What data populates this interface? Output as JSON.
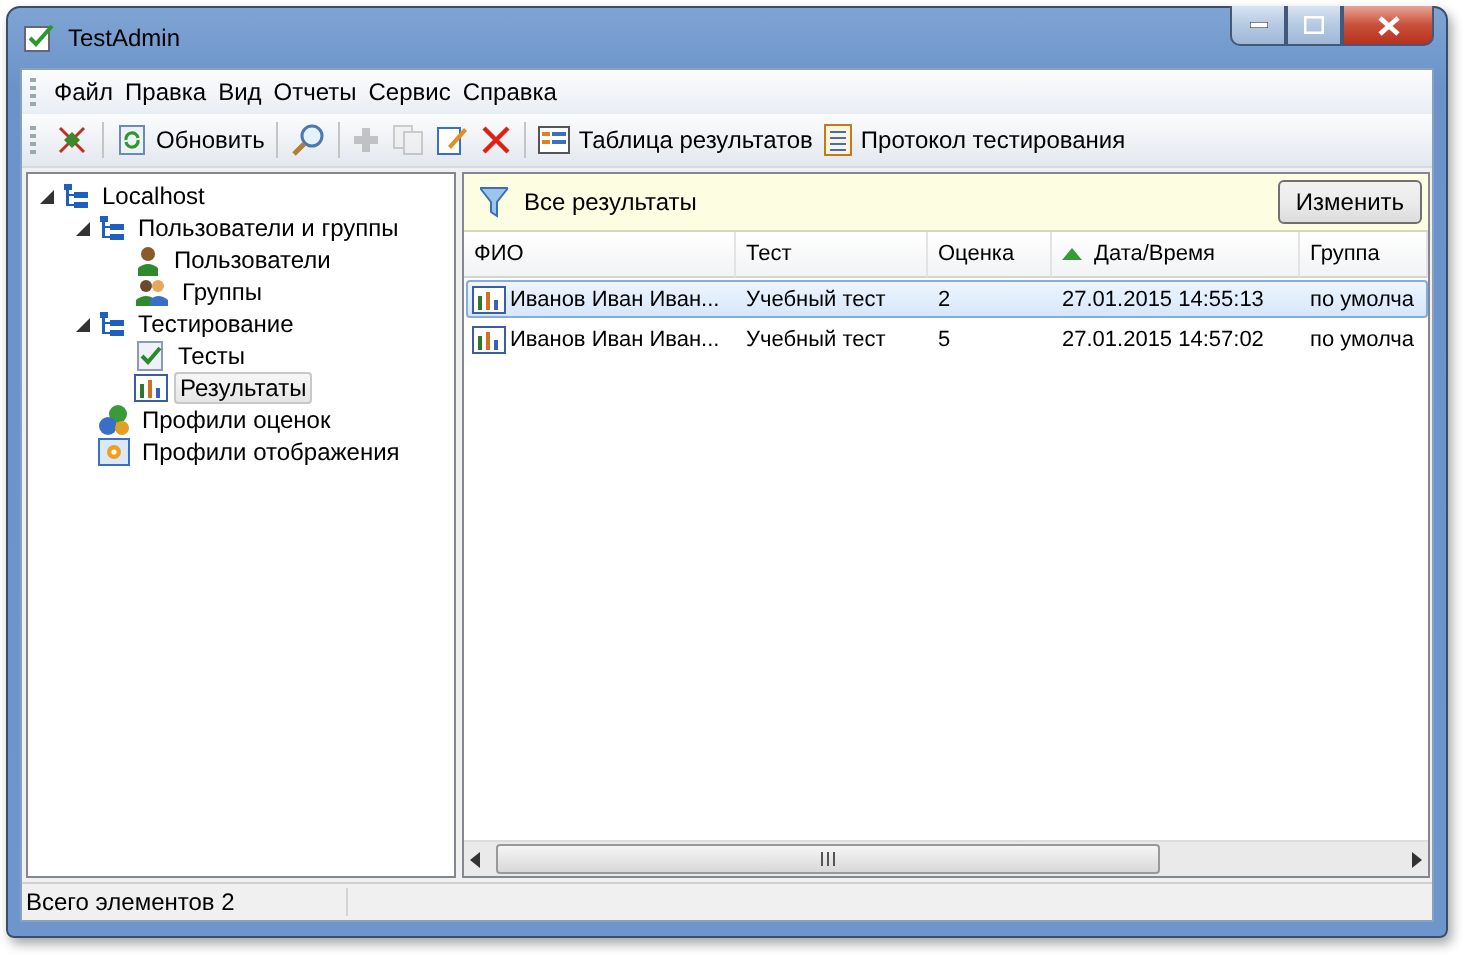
{
  "window": {
    "title": "TestAdmin"
  },
  "menu": [
    "Файл",
    "Правка",
    "Вид",
    "Отчеты",
    "Сервис",
    "Справка"
  ],
  "toolbar": {
    "groups": [
      [
        {
          "disabled": false
        }
      ],
      [
        {
          "label": "Обновить",
          "disabled": false
        }
      ],
      [
        {
          "disabled": false
        }
      ],
      [
        {
          "disabled": true
        },
        {
          "disabled": true
        },
        {
          "disabled": false
        },
        {
          "disabled": false
        }
      ],
      [
        {
          "label": "Таблица результатов",
          "disabled": false
        },
        {
          "label": "Протокол тестирования",
          "disabled": false
        }
      ]
    ]
  },
  "tree": [
    {
      "label": "Localhost",
      "expanded": true,
      "selected": false,
      "children": [
        {
          "label": "Пользователи и группы",
          "expanded": true,
          "selected": false,
          "children": [
            {
              "label": "Пользователи",
              "selected": false
            },
            {
              "label": "Группы",
              "selected": false
            }
          ]
        },
        {
          "label": "Тестирование",
          "expanded": true,
          "selected": false,
          "children": [
            {
              "label": "Тесты",
              "selected": false
            },
            {
              "label": "Результаты",
              "selected": true
            }
          ]
        },
        {
          "label": "Профили оценок",
          "selected": false
        },
        {
          "label": "Профили отображения",
          "selected": false
        }
      ]
    }
  ],
  "filter": {
    "label": "Все результаты",
    "button": "Изменить"
  },
  "table": {
    "columns": [
      {
        "label": "ФИО",
        "sorted": false
      },
      {
        "label": "Тест",
        "sorted": false
      },
      {
        "label": "Оценка",
        "sorted": false
      },
      {
        "label": "Дата/Время",
        "sorted": true
      },
      {
        "label": "Группа",
        "sorted": false
      }
    ],
    "rows": [
      {
        "cells": [
          "Иванов Иван Иван...",
          "Учебный тест",
          "2",
          "27.01.2015 14:55:13",
          "по умолча"
        ],
        "selected": true
      },
      {
        "cells": [
          "Иванов Иван Иван...",
          "Учебный тест",
          "5",
          "27.01.2015 14:57:02",
          "по умолча"
        ],
        "selected": false
      }
    ]
  },
  "status_bar": "Всего элементов 2"
}
